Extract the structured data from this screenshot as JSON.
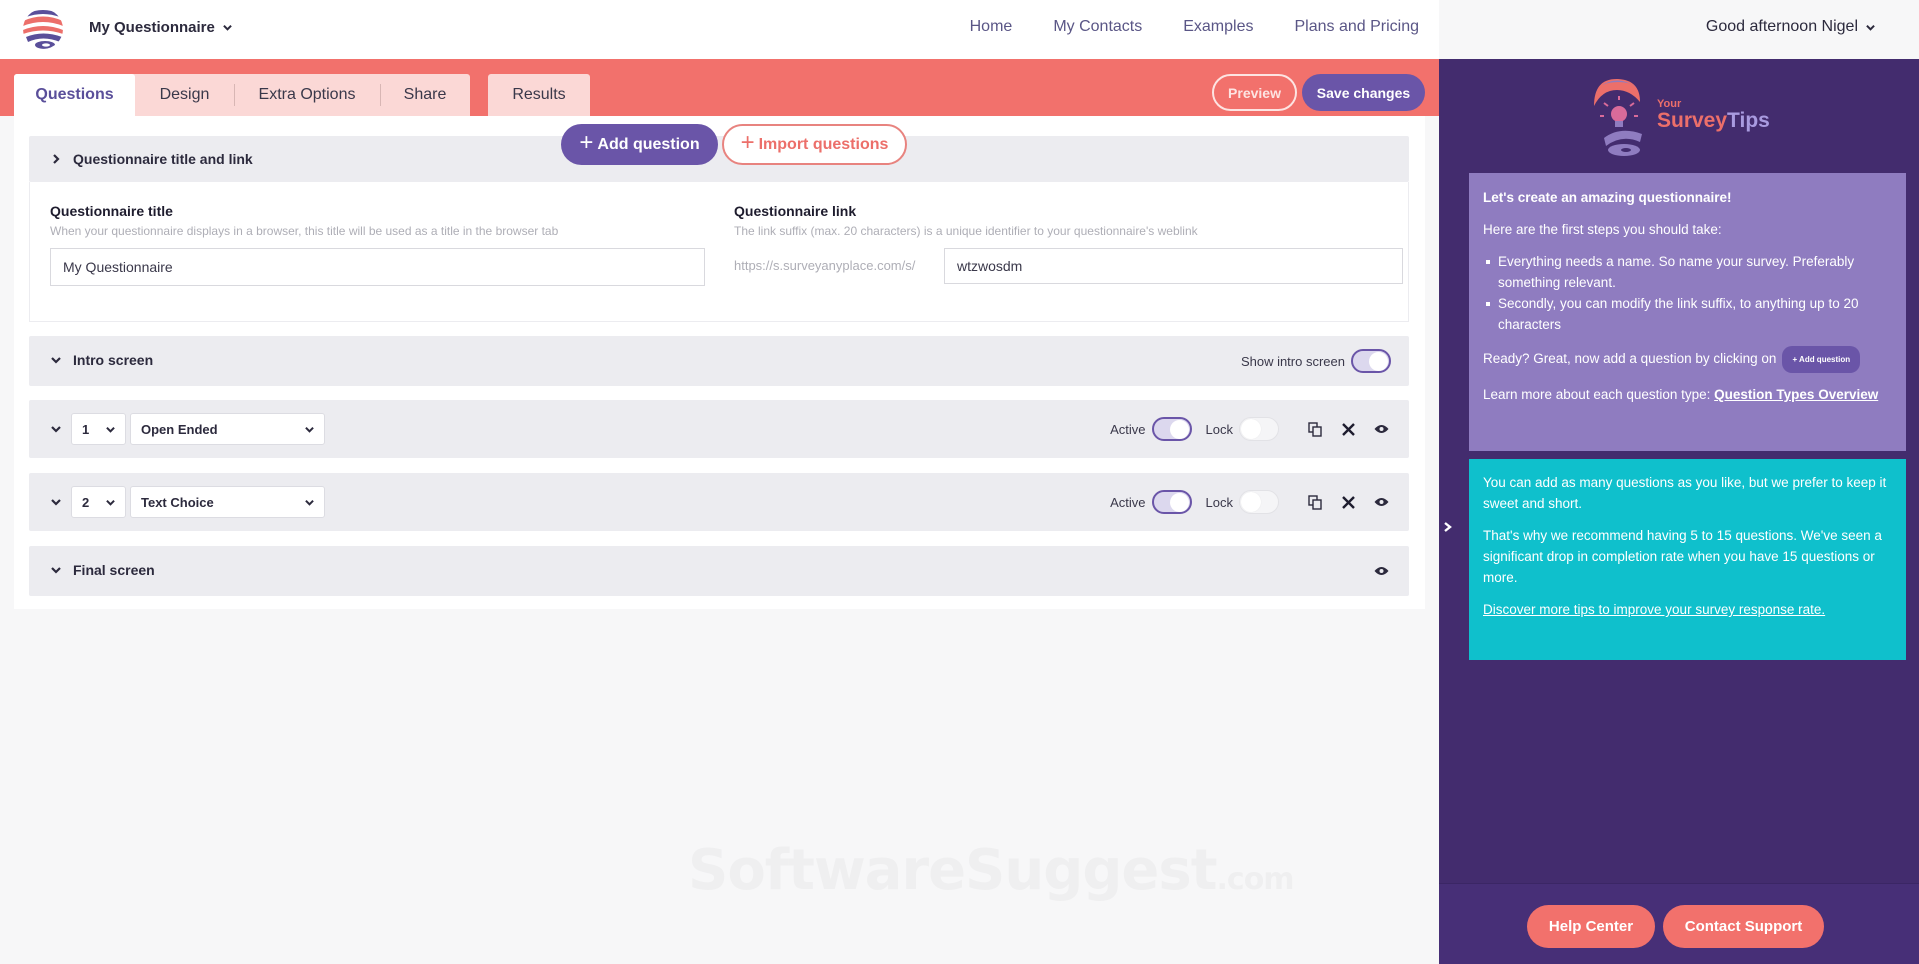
{
  "header": {
    "questionnaire_name": "My Questionnaire",
    "nav": [
      "Home",
      "My Contacts",
      "Examples",
      "Plans and Pricing"
    ],
    "greeting": "Good afternoon Nigel"
  },
  "tabs": {
    "items": [
      "Questions",
      "Design",
      "Extra Options",
      "Share"
    ],
    "active": "Questions",
    "results": "Results"
  },
  "toolbar": {
    "preview_label": "Preview",
    "save_label": "Save changes",
    "add_question_label": "Add question",
    "import_questions_label": "Import questions"
  },
  "title_section": {
    "heading": "Questionnaire title and link",
    "title_label": "Questionnaire title",
    "title_hint": "When your questionnaire displays in a browser, this title will be used as a title in the browser tab",
    "title_value": "My Questionnaire",
    "link_label": "Questionnaire link",
    "link_hint": "The link suffix (max. 20 characters) is a unique identifier to your questionnaire's weblink",
    "link_prefix": "https://s.surveyanyplace.com/s/",
    "link_value": "wtzwosdm"
  },
  "intro_screen": {
    "label": "Intro screen",
    "toggle_label": "Show intro screen",
    "toggle_on": true
  },
  "questions": [
    {
      "number": "1",
      "type": "Open Ended",
      "active_label": "Active",
      "active": true,
      "lock_label": "Lock",
      "locked": false
    },
    {
      "number": "2",
      "type": "Text Choice",
      "active_label": "Active",
      "active": true,
      "lock_label": "Lock",
      "locked": false
    }
  ],
  "final_screen": {
    "label": "Final screen"
  },
  "watermark": {
    "main": "SoftwareSuggest",
    "suffix": ".com"
  },
  "tips": {
    "brand_top": "Your",
    "brand_survey": "Survey",
    "brand_tips": "Tips",
    "card1": {
      "heading": "Let's create an amazing questionnaire!",
      "intro": "Here are the first steps you should take:",
      "bullets": [
        "Everything needs a name. So name your survey. Preferably something relevant.",
        "Secondly, you can modify the link suffix, to anything up to 20 characters"
      ],
      "ready_text": "Ready? Great, now add a question by clicking on",
      "ready_button": "+ Add question",
      "learn_text": "Learn more about each question type:",
      "learn_link": "Question Types Overview"
    },
    "card2": {
      "p1": "You can add as many questions as you like, but we prefer to keep it sweet and short.",
      "p2": "That's why we recommend having 5 to 15 questions. We've seen a significant drop in completion rate when you have 15 questions or more.",
      "link": "Discover more tips to improve your survey response rate."
    },
    "help_center": "Help Center",
    "contact_support": "Contact Support"
  },
  "colors": {
    "coral": "#f2716c",
    "purple": "#6a55a8",
    "panel": "#432c6e",
    "violet_card": "#8f7cc0",
    "cyan_card": "#0fc0cc"
  }
}
